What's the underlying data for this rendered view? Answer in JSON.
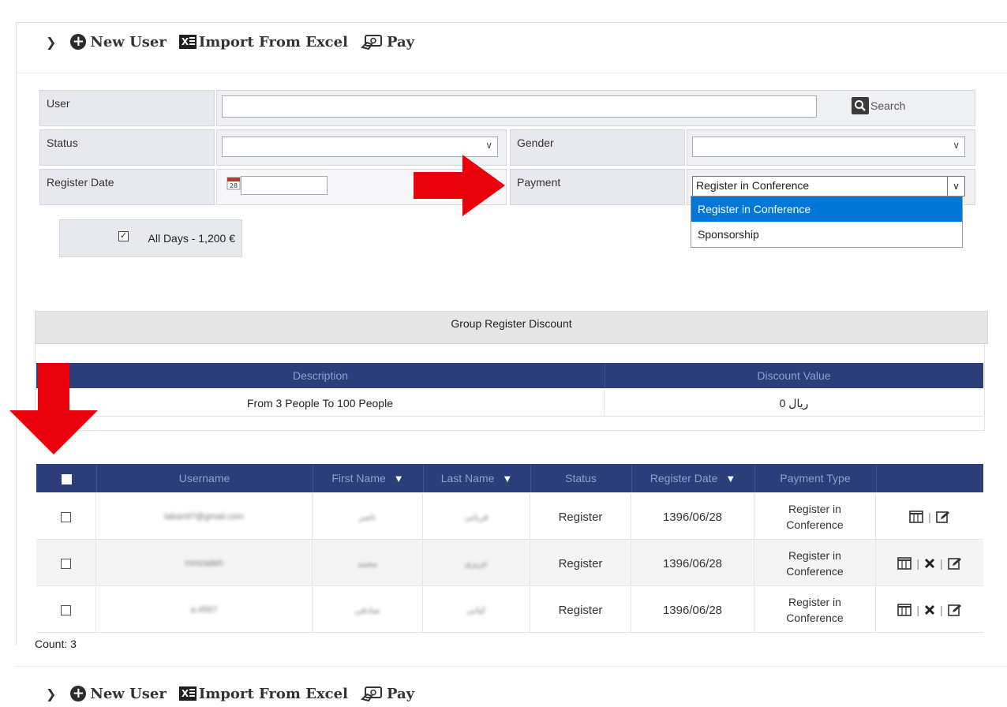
{
  "toolbar": {
    "new_user": "New User",
    "import_excel": "Import From Excel",
    "pay": "Pay",
    "excel_glyph": "X"
  },
  "filters": {
    "user_label": "User",
    "user_value": "",
    "search_label": "Search",
    "status_label": "Status",
    "status_value": "",
    "gender_label": "Gender",
    "gender_value": "",
    "register_date_label": "Register Date",
    "register_date_value": "",
    "calendar_day": "28",
    "payment_label": "Payment",
    "payment_value": "Register in Conference",
    "payment_options": [
      "Register in Conference",
      "Sponsorship"
    ],
    "all_days": "All Days - 1,200 €"
  },
  "discount": {
    "title": "Group Register Discount",
    "columns": [
      "Description",
      "Discount Value"
    ],
    "rows": [
      {
        "description": "From 3 People To 100 People",
        "value": "0 ریال"
      }
    ]
  },
  "grid": {
    "columns": [
      "Username",
      "First Name",
      "Last Name",
      "Status",
      "Register Date",
      "Payment Type"
    ],
    "rows": [
      {
        "username": "taban97@gmail.com",
        "first": "ناصر",
        "last": "قربانی",
        "status": "Register",
        "date": "1396/06/28",
        "payment": [
          "Register in",
          "Conference"
        ]
      },
      {
        "username": "mmzadeh",
        "first": "محمد",
        "last": "عزیزی",
        "status": "Register",
        "date": "1396/06/28",
        "payment": [
          "Register in",
          "Conference"
        ]
      },
      {
        "username": "a.4567",
        "first": "صادقی",
        "last": "کیانی",
        "status": "Register",
        "date": "1396/06/28",
        "payment": [
          "Register in",
          "Conference"
        ]
      }
    ],
    "count": "Count: 3"
  },
  "colors": {
    "grid_header_bg": "#2c3e7a",
    "grid_header_text": "#8fa0c8",
    "dropdown_selected": "#0078d7",
    "arrow": "#e8000b"
  }
}
